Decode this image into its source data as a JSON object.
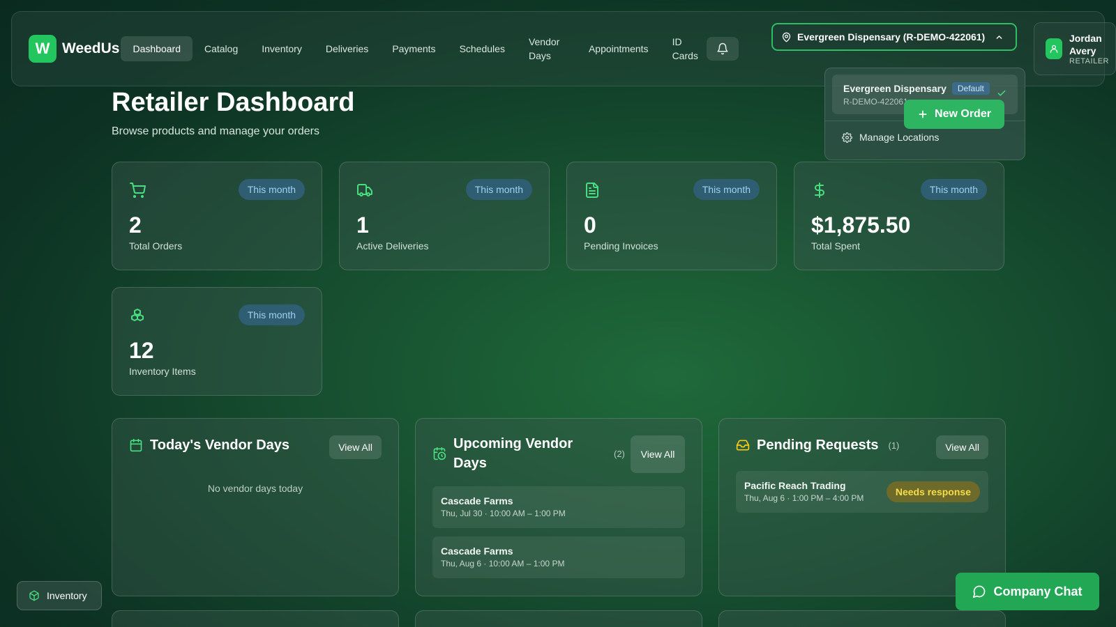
{
  "brand": {
    "logo_letter": "W",
    "name": "WeedUs"
  },
  "nav": {
    "items": [
      {
        "label": "Dashboard",
        "active": true
      },
      {
        "label": "Catalog"
      },
      {
        "label": "Inventory"
      },
      {
        "label": "Deliveries"
      },
      {
        "label": "Payments"
      },
      {
        "label": "Schedules"
      },
      {
        "label": "Vendor Days"
      },
      {
        "label": "Appointments"
      },
      {
        "label": "ID Cards"
      }
    ],
    "bell_icon": "bell-icon"
  },
  "location_select": {
    "value": "Evergreen Dispensary (R-DEMO-422061)"
  },
  "user": {
    "first": "Jordan",
    "last": "Avery",
    "role": "RETAILER"
  },
  "location_dropdown": {
    "item_name": "Evergreen Dispensary",
    "item_badge": "Default",
    "item_code": "R-DEMO-422061",
    "manage_label": "Manage Locations"
  },
  "new_order_label": "New Order",
  "page": {
    "title": "Retailer Dashboard",
    "subtitle": "Browse products and manage your orders"
  },
  "stats": [
    {
      "icon": "cart-icon",
      "badge": "This month",
      "value": "2",
      "label": "Total Orders"
    },
    {
      "icon": "truck-icon",
      "badge": "This month",
      "value": "1",
      "label": "Active Deliveries"
    },
    {
      "icon": "document-icon",
      "badge": "This month",
      "value": "0",
      "label": "Pending Invoices"
    },
    {
      "icon": "dollar-icon",
      "badge": "This month",
      "value": "$1,875.50",
      "label": "Total Spent"
    },
    {
      "icon": "boxes-icon",
      "badge": "This month",
      "value": "12",
      "label": "Inventory Items"
    }
  ],
  "panels": {
    "today": {
      "title": "Today's Vendor Days",
      "view_all": "View All",
      "empty": "No vendor days today"
    },
    "upcoming": {
      "title": "Upcoming Vendor Days",
      "count": "(2)",
      "view_all": "View All",
      "items": [
        {
          "name": "Cascade Farms",
          "time": "Thu, Jul 30 · 10:00 AM – 1:00 PM"
        },
        {
          "name": "Cascade Farms",
          "time": "Thu, Aug 6 · 10:00 AM – 1:00 PM"
        }
      ]
    },
    "pending": {
      "title": "Pending Requests",
      "count": "(1)",
      "view_all": "View All",
      "items": [
        {
          "name": "Pacific Reach Trading",
          "time": "Thu, Aug 6 · 1:00 PM – 4:00 PM",
          "status": "Needs response"
        }
      ]
    }
  },
  "floating": {
    "inventory_label": "Inventory",
    "chat_label": "Company Chat"
  },
  "colors": {
    "accent": "#22c55e",
    "badge_bg": "#2f5d72",
    "badge_text": "#9fd2f2",
    "warning_text": "#f5dd4a"
  }
}
